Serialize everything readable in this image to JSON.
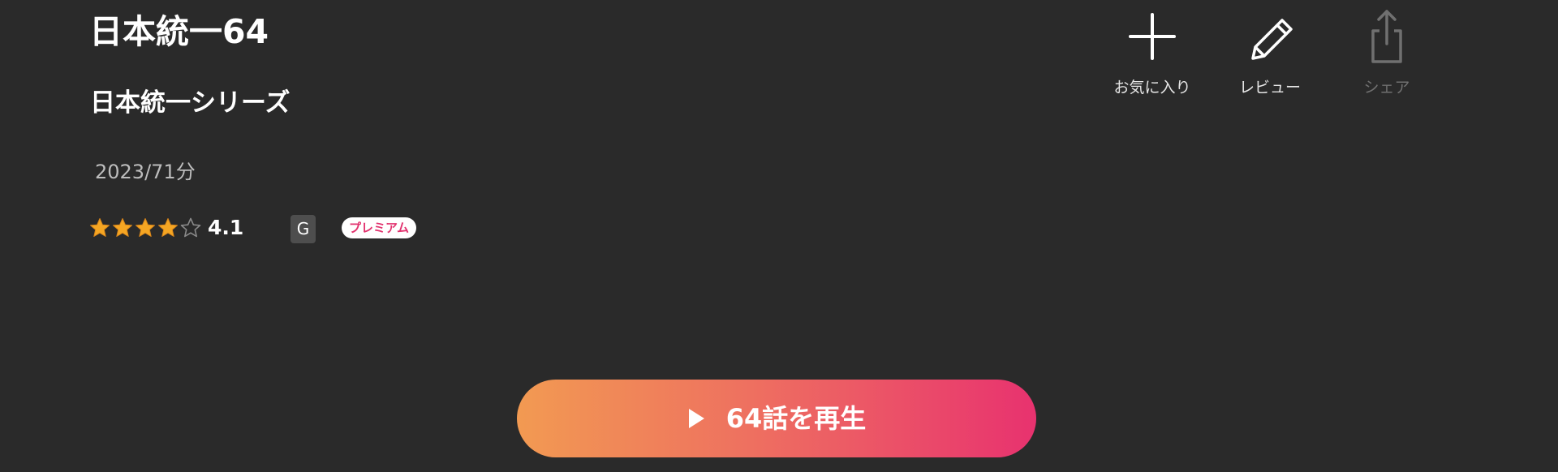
{
  "content": {
    "title": "日本統一64",
    "series": "日本統一シリーズ",
    "meta": "2023/71分",
    "rating": {
      "value": "4.1",
      "stars": 4,
      "max_stars": 5,
      "filled_color": "#f5a623",
      "empty_color": "#8a8a8a"
    },
    "rating_badge": "G",
    "premium_badge": "プレミアム"
  },
  "actions": {
    "favorite": {
      "label": "お気に入り",
      "icon": "plus-icon"
    },
    "review": {
      "label": "レビュー",
      "icon": "pencil-icon"
    },
    "share": {
      "label": "シェア",
      "icon": "share-icon",
      "disabled": true
    }
  },
  "play": {
    "label": "64話を再生",
    "icon": "play-icon",
    "gradient_start": "#f29a52",
    "gradient_end": "#e8326f"
  },
  "colors": {
    "background": "#2a2a2a",
    "text": "#ffffff",
    "muted_text": "#bdbdbd"
  }
}
